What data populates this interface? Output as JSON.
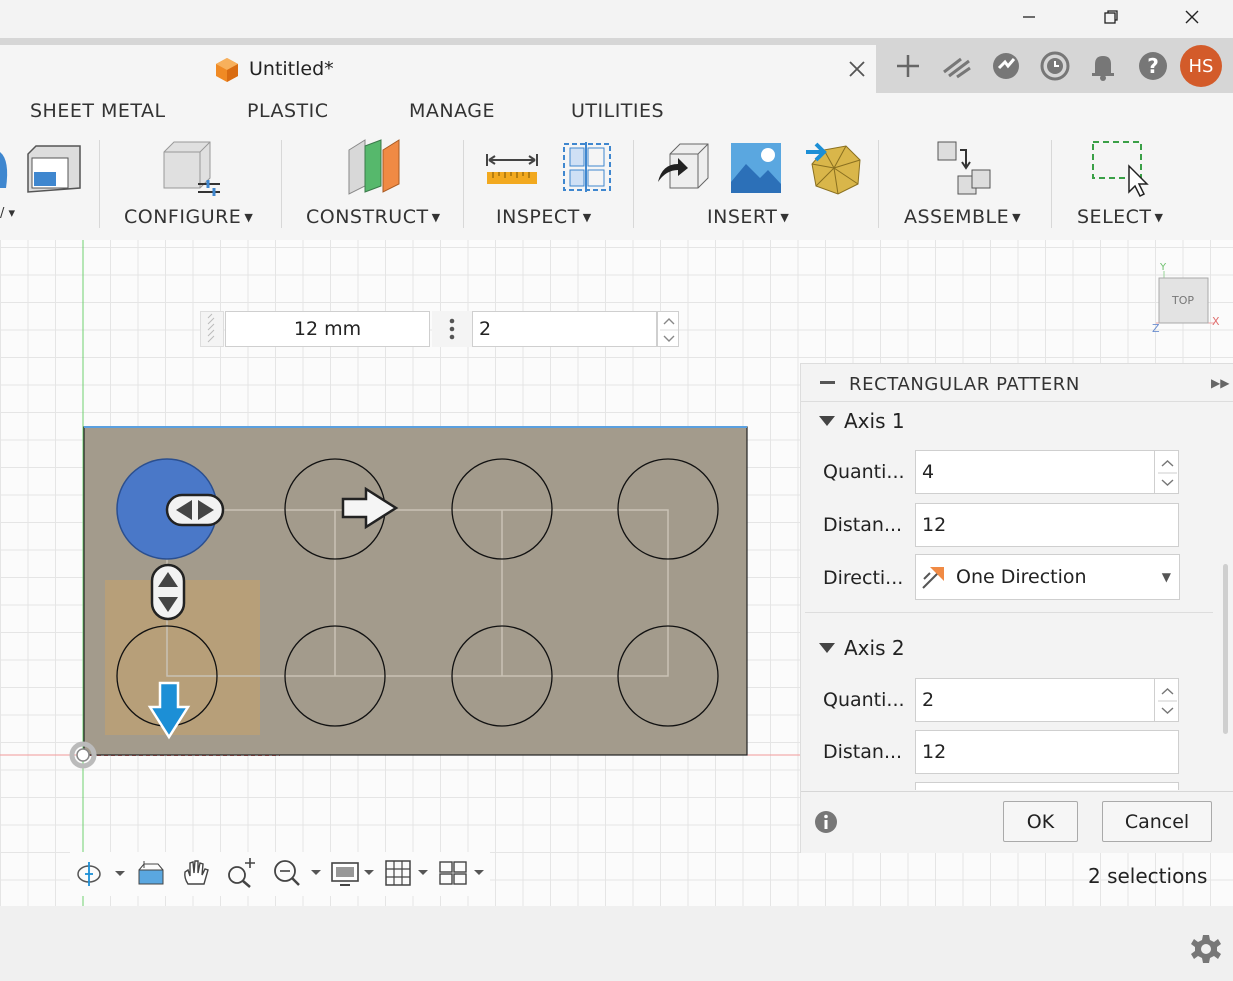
{
  "window": {
    "minimize_icon": "minimize-icon",
    "restore_icon": "restore-icon",
    "close_icon": "close-icon"
  },
  "document": {
    "title": "Untitled*",
    "close_icon": "close-icon"
  },
  "header_icons": [
    "plus-icon",
    "extensions-icon",
    "online-icon",
    "job-status-icon",
    "notification-icon",
    "help-icon"
  ],
  "user": {
    "initials": "HS",
    "color": "#d35b2a"
  },
  "ribbon": {
    "tabs": [
      "SHEET METAL",
      "PLASTIC",
      "MANAGE",
      "UTILITIES"
    ],
    "groups": [
      {
        "label": "CONFIGURE"
      },
      {
        "label": "CONSTRUCT"
      },
      {
        "label": "INSPECT"
      },
      {
        "label": "INSERT"
      },
      {
        "label": "ASSEMBLE"
      },
      {
        "label": "SELECT"
      }
    ]
  },
  "sketch_inputs": {
    "distance_value": "12 mm",
    "quantity_value": "2"
  },
  "viewcube": {
    "face_label": "TOP",
    "axis_y": "Y",
    "axis_x": "X",
    "axis_z": "Z"
  },
  "panel": {
    "title": "RECTANGULAR PATTERN",
    "axis1": {
      "header": "Axis 1",
      "quantity_label": "Quanti...",
      "quantity_value": "4",
      "distance_label": "Distan...",
      "distance_value": "12",
      "direction_label": "Directi...",
      "direction_value": "One Direction"
    },
    "axis2": {
      "header": "Axis 2",
      "quantity_label": "Quanti...",
      "quantity_value": "2",
      "distance_label": "Distan...",
      "distance_value": "12"
    },
    "ok_label": "OK",
    "cancel_label": "Cancel"
  },
  "status": {
    "selections_text": "2 selections"
  },
  "colors": {
    "accent_blue": "#4a78c8",
    "plate": "#a39b8c",
    "arrow_blue": "#1c8fd6"
  }
}
